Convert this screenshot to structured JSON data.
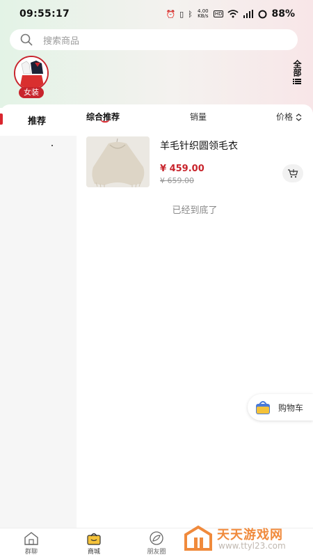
{
  "status_bar": {
    "time": "09:55:17",
    "network_speed": "4.00\nKB/s",
    "hd_label": "HD",
    "battery": "88%"
  },
  "search": {
    "placeholder": "搜索商品"
  },
  "categories": [
    {
      "label": "女装",
      "icon": "clothing-thumbnail"
    }
  ],
  "all_button": {
    "label": "全部",
    "icon": "list-menu-icon"
  },
  "left_nav": {
    "items": [
      {
        "label": "推荐",
        "active": true
      }
    ]
  },
  "sort_bar": {
    "items": [
      {
        "label": "综合推荐",
        "active": true
      },
      {
        "label": "销量",
        "active": false
      },
      {
        "label": "价格",
        "active": false,
        "icon": "sort-arrows-icon"
      }
    ]
  },
  "products": [
    {
      "name": "羊毛针织圆领毛衣",
      "price": "¥ 459.00",
      "original_price": "¥ 659.00",
      "cart_icon": "add-cart-icon"
    }
  ],
  "list_end_text": "已经到底了",
  "floating_cart": {
    "label": "购物车",
    "icon": "shopping-bag-icon"
  },
  "tabbar": {
    "items": [
      {
        "label": "群聊",
        "icon": "home-icon",
        "active": false
      },
      {
        "label": "商城",
        "icon": "shop-bag-icon",
        "active": true
      },
      {
        "label": "朋友圈",
        "icon": "leaf-icon",
        "active": false
      }
    ]
  },
  "watermark": {
    "title": "天天游戏网",
    "url": "www.ttyl23.com"
  },
  "colors": {
    "accent": "#d9262e",
    "price": "#c8242c",
    "watermark": "#f08a3c"
  }
}
